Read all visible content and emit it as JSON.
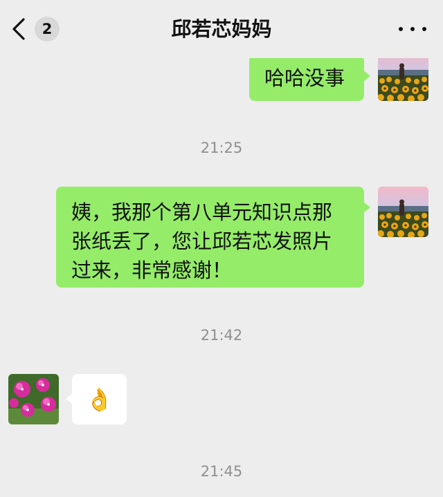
{
  "header": {
    "back_badge": "2",
    "title": "邱若芯妈妈"
  },
  "messages": [
    {
      "sender": "me",
      "text": "哈哈没事"
    },
    {
      "type": "time",
      "text": "21:25"
    },
    {
      "sender": "me",
      "text": "姨，我那个第八单元知识点那张纸丢了，您让邱若芯发照片过来，非常感谢！"
    },
    {
      "type": "time",
      "text": "21:42"
    },
    {
      "sender": "other",
      "text": "👌"
    },
    {
      "type": "time",
      "text": "21:45"
    }
  ],
  "icons": {
    "back": "chevron-left-icon",
    "more": "more-dots-icon",
    "my_avatar": "sunflower-field-avatar",
    "contact_avatar": "pink-flowers-avatar"
  },
  "colors": {
    "background": "#ededed",
    "my_bubble": "#95ec69",
    "other_bubble": "#ffffff",
    "timestamp": "#8f8f8f"
  }
}
